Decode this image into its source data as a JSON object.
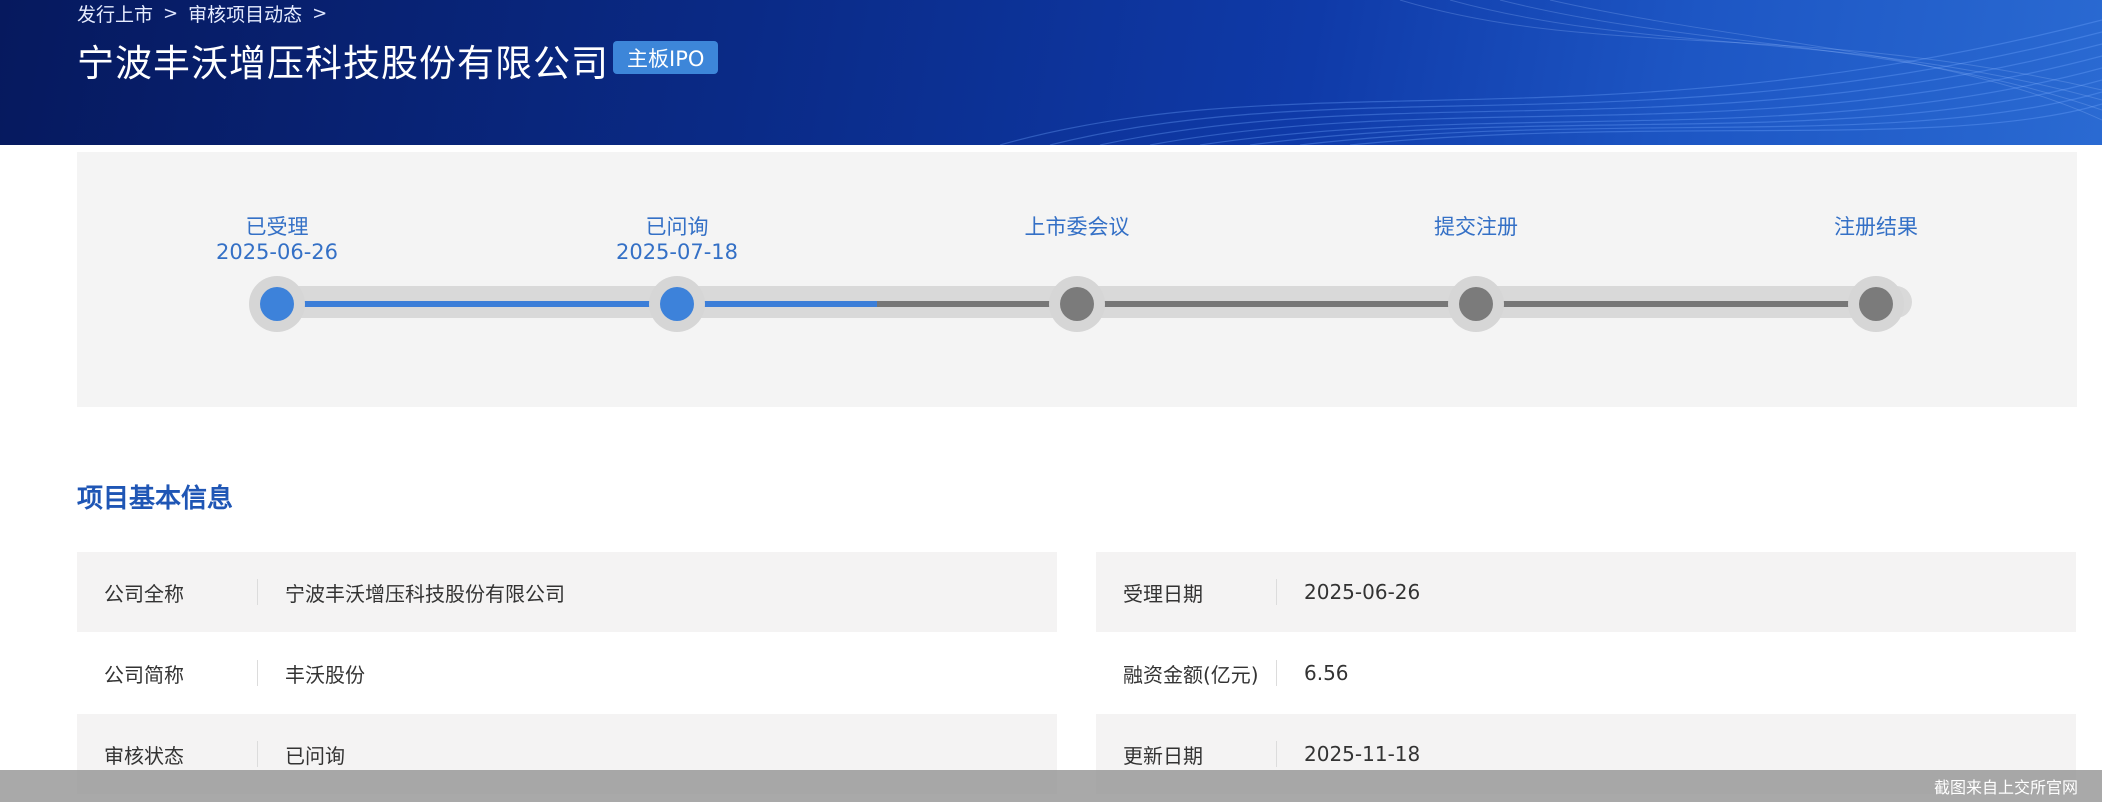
{
  "header": {
    "breadcrumb": [
      "发行上市",
      "审核项目动态"
    ],
    "breadcrumb_separator": ">",
    "company_name": "宁波丰沃增压科技股份有限公司",
    "board_badge": "主板IPO"
  },
  "progress": {
    "steps": [
      {
        "label": "已受理",
        "date": "2025-06-26",
        "status": "done"
      },
      {
        "label": "已问询",
        "date": "2025-07-18",
        "status": "done"
      },
      {
        "label": "上市委会议",
        "date": "",
        "status": "pending"
      },
      {
        "label": "提交注册",
        "date": "",
        "status": "pending"
      },
      {
        "label": "注册结果",
        "date": "",
        "status": "pending"
      }
    ],
    "colors": {
      "done": "#3d82da",
      "pending": "#7b7b7b",
      "label": "#3470c6"
    }
  },
  "section": {
    "title": "项目基本信息"
  },
  "info": {
    "left": [
      {
        "label": "公司全称",
        "value": "宁波丰沃增压科技股份有限公司"
      },
      {
        "label": "公司简称",
        "value": "丰沃股份"
      },
      {
        "label": "审核状态",
        "value": "已问询"
      }
    ],
    "right": [
      {
        "label": "受理日期",
        "value": "2025-06-26"
      },
      {
        "label": "融资金额(亿元)",
        "value": "6.56"
      },
      {
        "label": "更新日期",
        "value": "2025-11-18"
      }
    ]
  },
  "watermark": "截图来自上交所官网"
}
